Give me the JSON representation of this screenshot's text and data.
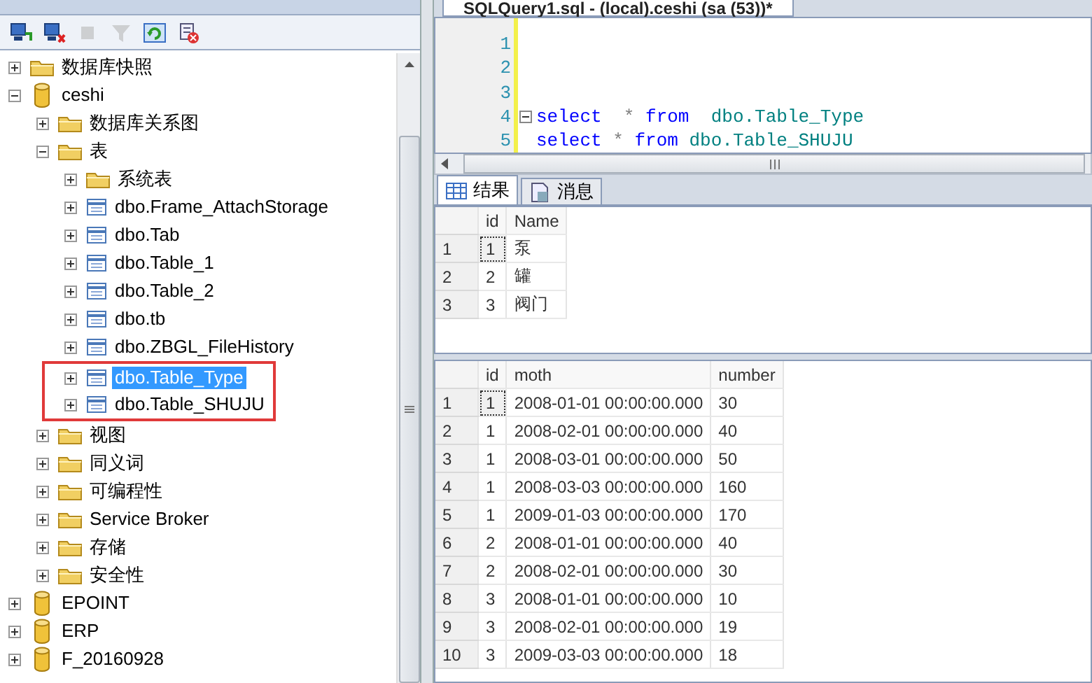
{
  "object_explorer": {
    "toolbar": [
      {
        "kind": "connect",
        "disabled": false
      },
      {
        "kind": "disconnect",
        "disabled": false
      },
      {
        "kind": "stop",
        "disabled": true
      },
      {
        "kind": "filter",
        "disabled": true
      },
      {
        "kind": "refresh",
        "disabled": false
      },
      {
        "kind": "script",
        "disabled": false
      }
    ],
    "tree": [
      {
        "label": "数据库快照",
        "kind": "folder",
        "expanded": false,
        "selected": false,
        "boxed": false
      },
      {
        "label": "ceshi",
        "kind": "database",
        "expanded": true,
        "selected": false,
        "boxed": false,
        "children": [
          {
            "label": "数据库关系图",
            "kind": "folder",
            "expanded": false,
            "selected": false,
            "boxed": false
          },
          {
            "label": "表",
            "kind": "folder",
            "expanded": true,
            "selected": false,
            "boxed": false,
            "children": [
              {
                "label": "系统表",
                "kind": "folder",
                "expanded": false,
                "selected": false,
                "boxed": false
              },
              {
                "label": "dbo.Frame_AttachStorage",
                "kind": "table",
                "expanded": false,
                "selected": false,
                "boxed": false
              },
              {
                "label": "dbo.Tab",
                "kind": "table",
                "expanded": false,
                "selected": false,
                "boxed": false
              },
              {
                "label": "dbo.Table_1",
                "kind": "table",
                "expanded": false,
                "selected": false,
                "boxed": false
              },
              {
                "label": "dbo.Table_2",
                "kind": "table",
                "expanded": false,
                "selected": false,
                "boxed": false
              },
              {
                "label": "dbo.tb",
                "kind": "table",
                "expanded": false,
                "selected": false,
                "boxed": false
              },
              {
                "label": "dbo.ZBGL_FileHistory",
                "kind": "table",
                "expanded": false,
                "selected": false,
                "boxed": false
              },
              {
                "label": "dbo.Table_Type",
                "kind": "table",
                "expanded": false,
                "selected": true,
                "boxed": true
              },
              {
                "label": "dbo.Table_SHUJU",
                "kind": "table",
                "expanded": false,
                "selected": false,
                "boxed": true
              }
            ]
          },
          {
            "label": "视图",
            "kind": "folder",
            "expanded": false,
            "selected": false,
            "boxed": false
          },
          {
            "label": "同义词",
            "kind": "folder",
            "expanded": false,
            "selected": false,
            "boxed": false
          },
          {
            "label": "可编程性",
            "kind": "folder",
            "expanded": false,
            "selected": false,
            "boxed": false
          },
          {
            "label": "Service Broker",
            "kind": "folder",
            "expanded": false,
            "selected": false,
            "boxed": false
          },
          {
            "label": "存储",
            "kind": "folder",
            "expanded": false,
            "selected": false,
            "boxed": false
          },
          {
            "label": "安全性",
            "kind": "folder",
            "expanded": false,
            "selected": false,
            "boxed": false
          }
        ]
      },
      {
        "label": "EPOINT",
        "kind": "database",
        "expanded": false,
        "selected": false,
        "boxed": false
      },
      {
        "label": "ERP",
        "kind": "database",
        "expanded": false,
        "selected": false,
        "boxed": false
      },
      {
        "label": "F_20160928",
        "kind": "database",
        "expanded": false,
        "selected": false,
        "boxed": false
      }
    ]
  },
  "editor": {
    "tab_title": "SQLQuery1.sql - (local).ceshi (sa (53))*",
    "lines": [
      {
        "number": "1"
      },
      {
        "number": "2"
      },
      {
        "number": "3"
      },
      {
        "number": "4",
        "collapsible": true,
        "tokens": [
          {
            "kind": "keyword",
            "text": "select  "
          },
          {
            "kind": "operator",
            "text": "* "
          },
          {
            "kind": "keyword",
            "text": "from  "
          },
          {
            "kind": "identifier",
            "text": "dbo.Table_Type"
          }
        ]
      },
      {
        "number": "5",
        "collapsible": false,
        "tokens": [
          {
            "kind": "keyword",
            "text": "select "
          },
          {
            "kind": "operator",
            "text": "* "
          },
          {
            "kind": "keyword",
            "text": "from "
          },
          {
            "kind": "identifier",
            "text": "dbo.Table_SHUJU"
          }
        ]
      }
    ]
  },
  "results": {
    "tabs": [
      {
        "label": "结果",
        "kind": "grid",
        "selected": true
      },
      {
        "label": "消息",
        "kind": "messages",
        "selected": false
      }
    ],
    "grids": [
      {
        "columns": [
          "id",
          "Name"
        ],
        "rows": [
          {
            "number": "1",
            "focused": true,
            "cells": [
              "1",
              "泵"
            ]
          },
          {
            "number": "2",
            "focused": false,
            "cells": [
              "2",
              "罐"
            ]
          },
          {
            "number": "3",
            "focused": false,
            "cells": [
              "3",
              "阀门"
            ]
          }
        ]
      },
      {
        "columns": [
          "id",
          "moth",
          "number"
        ],
        "rows": [
          {
            "number": "1",
            "focused": true,
            "cells": [
              "1",
              "2008-01-01 00:00:00.000",
              "30"
            ]
          },
          {
            "number": "2",
            "focused": false,
            "cells": [
              "1",
              "2008-02-01 00:00:00.000",
              "40"
            ]
          },
          {
            "number": "3",
            "focused": false,
            "cells": [
              "1",
              "2008-03-01 00:00:00.000",
              "50"
            ]
          },
          {
            "number": "4",
            "focused": false,
            "cells": [
              "1",
              "2008-03-03 00:00:00.000",
              "160"
            ]
          },
          {
            "number": "5",
            "focused": false,
            "cells": [
              "1",
              "2009-01-03 00:00:00.000",
              "170"
            ]
          },
          {
            "number": "6",
            "focused": false,
            "cells": [
              "2",
              "2008-01-01 00:00:00.000",
              "40"
            ]
          },
          {
            "number": "7",
            "focused": false,
            "cells": [
              "2",
              "2008-02-01 00:00:00.000",
              "30"
            ]
          },
          {
            "number": "8",
            "focused": false,
            "cells": [
              "3",
              "2008-01-01 00:00:00.000",
              "10"
            ]
          },
          {
            "number": "9",
            "focused": false,
            "cells": [
              "3",
              "2008-02-01 00:00:00.000",
              "19"
            ]
          },
          {
            "number": "10",
            "focused": false,
            "cells": [
              "3",
              "2009-03-03 00:00:00.000",
              "18"
            ]
          }
        ]
      }
    ]
  }
}
